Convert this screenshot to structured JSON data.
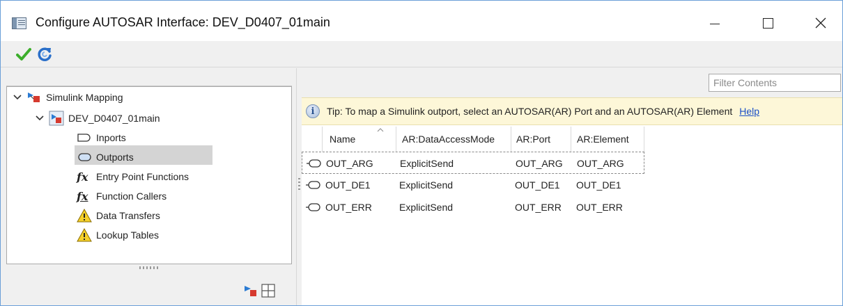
{
  "window": {
    "title": "Configure AUTOSAR Interface: DEV_D0407_01main",
    "controls": [
      "minimize",
      "maximize",
      "close"
    ]
  },
  "toolbar": {
    "buttons": [
      {
        "icon": "checkmark-icon",
        "color": "#3cae2b"
      },
      {
        "icon": "refresh-icon",
        "color": "#2a6fc9"
      }
    ]
  },
  "tree": {
    "root": {
      "label": "Simulink Mapping",
      "expanded": true
    },
    "model": {
      "label": "DEV_D0407_01main",
      "expanded": true
    },
    "items": [
      {
        "label": "Inports",
        "icon": "inport-icon"
      },
      {
        "label": "Outports",
        "icon": "outport-icon",
        "selected": true
      },
      {
        "label": "Entry Point Functions",
        "icon": "fx-icon"
      },
      {
        "label": "Function Callers",
        "icon": "fx-caller-icon"
      },
      {
        "label": "Data Transfers",
        "icon": "warning-icon"
      },
      {
        "label": "Lookup Tables",
        "icon": "warning-icon"
      }
    ]
  },
  "filter": {
    "placeholder": "Filter Contents",
    "value": ""
  },
  "tip": {
    "text": "Tip: To map a Simulink outport, select an AUTOSAR(AR) Port and an AUTOSAR(AR) Element",
    "help_label": "Help"
  },
  "table": {
    "columns": [
      "Name",
      "AR:DataAccessMode",
      "AR:Port",
      "AR:Element"
    ],
    "sorted_column": "Name",
    "rows": [
      {
        "name": "OUT_ARG",
        "mode": "ExplicitSend",
        "port": "OUT_ARG",
        "element": "OUT_ARG"
      },
      {
        "name": "OUT_DE1",
        "mode": "ExplicitSend",
        "port": "OUT_DE1",
        "element": "OUT_DE1"
      },
      {
        "name": "OUT_ERR",
        "mode": "ExplicitSend",
        "port": "OUT_ERR",
        "element": "OUT_ERR"
      }
    ]
  },
  "colors": {
    "tip_background": "#fdf7d8",
    "link": "#1a4fc7",
    "selection": "#d4d4d4",
    "window_border": "#6a9fd8"
  }
}
